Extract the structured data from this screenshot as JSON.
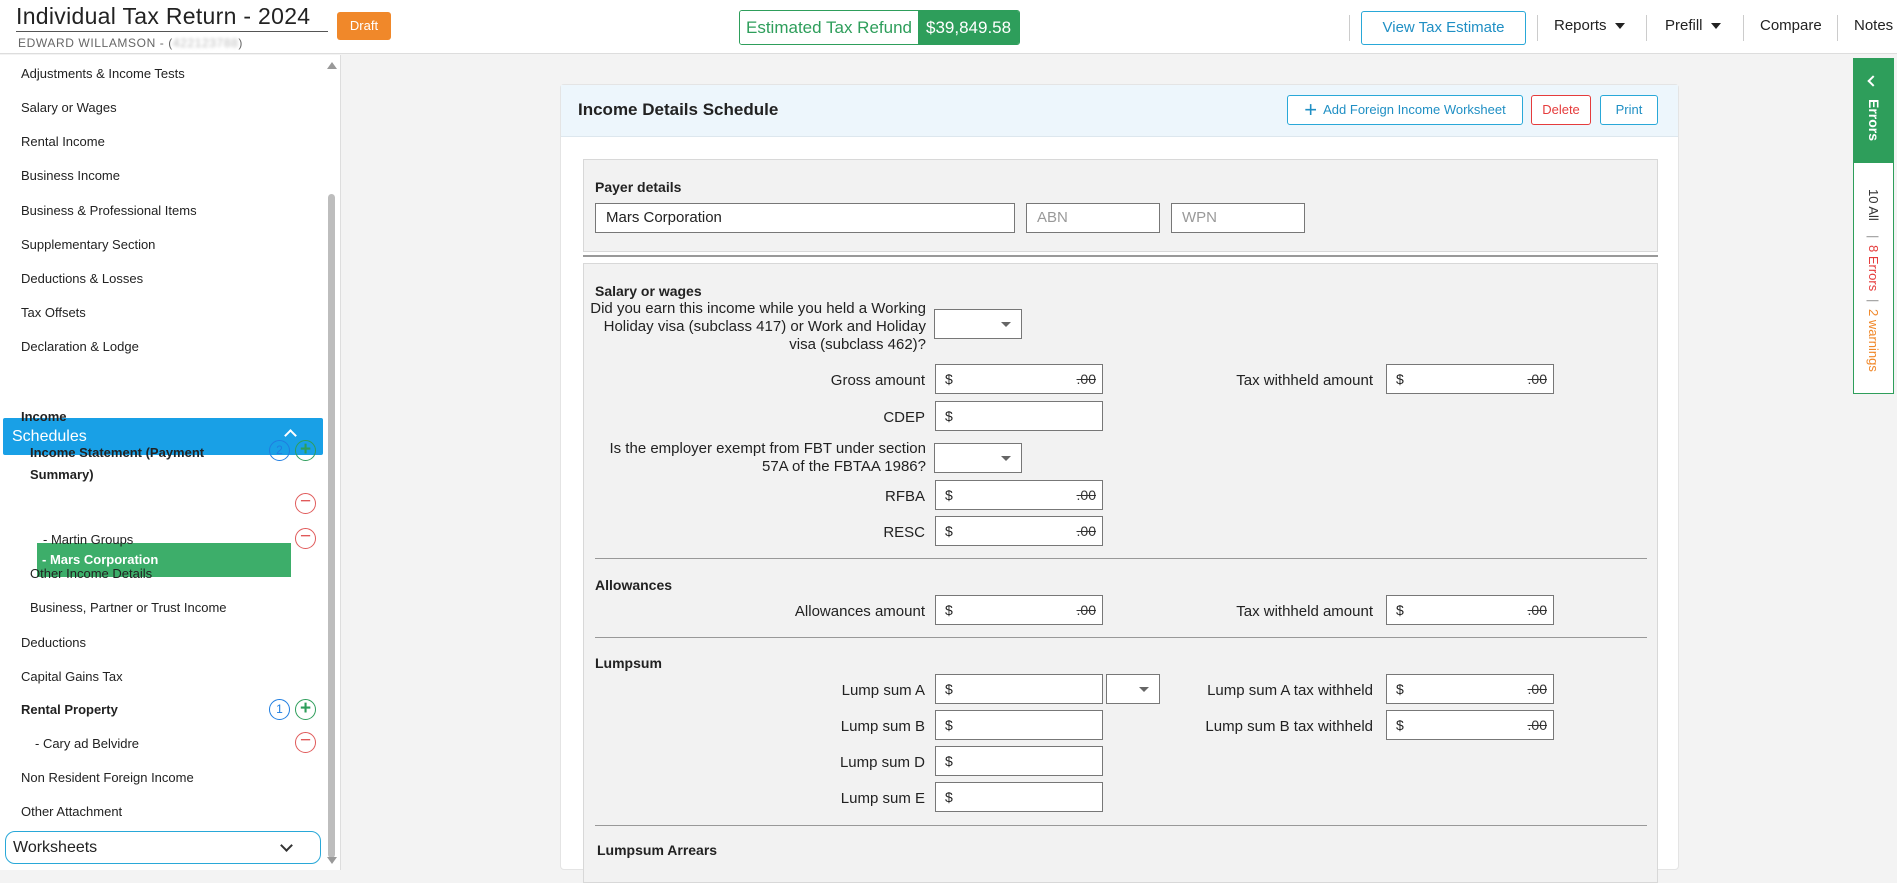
{
  "header": {
    "title": "Individual Tax Return - 2024",
    "client_name": "EDWARD WILLAMSON - (",
    "client_id_masked": "422123788",
    "client_close": ")",
    "status_badge": "Draft",
    "refund_label": "Estimated Tax Refund",
    "refund_amount": "$39,849.58",
    "view_estimate": "View Tax Estimate",
    "nav": [
      "Reports",
      "Prefill",
      "Compare",
      "Notes"
    ]
  },
  "sidebar": {
    "top_items": [
      "Adjustments & Income Tests",
      "Salary or Wages",
      "Rental Income",
      "Business Income",
      "Business & Professional Items",
      "Supplementary Section",
      "Deductions & Losses",
      "Tax Offsets",
      "Declaration & Lodge"
    ],
    "schedules_label": "Schedules",
    "income_label": "Income",
    "income_statement_label": "Income Statement (Payment Summary)",
    "income_statement_count": "2",
    "payers": [
      "- Mars Corporation",
      "- Martin Groups"
    ],
    "other_income": "Other Income Details",
    "business_partner": "Business, Partner or Trust Income",
    "deductions": "Deductions",
    "cgt": "Capital Gains Tax",
    "rental_property": "Rental Property",
    "rental_count": "1",
    "rental_items": [
      "- Cary ad Belvidre"
    ],
    "non_resident": "Non Resident Foreign Income",
    "other_attachment": "Other Attachment",
    "worksheets": "Worksheets"
  },
  "card": {
    "title": "Income Details Schedule",
    "add_foreign": "Add Foreign Income Worksheet",
    "delete": "Delete",
    "print": "Print"
  },
  "payer": {
    "section": "Payer details",
    "name_value": "Mars Corporation",
    "abn_placeholder": "ABN",
    "wpn_placeholder": "WPN"
  },
  "salary": {
    "section": "Salary or wages",
    "whm_question": "Did you earn this income while you held a Working Holiday visa (subclass 417) or Work and Holiday visa (subclass 462)?",
    "gross_label": "Gross amount",
    "tax_withheld_label": "Tax withheld amount",
    "cdep_label": "CDEP",
    "fbt_question": "Is the employer exempt from FBT under section 57A of the FBTAA 1986?",
    "rfba_label": "RFBA",
    "resc_label": "RESC"
  },
  "allowances": {
    "section": "Allowances",
    "amount_label": "Allowances amount",
    "tax_withheld_label": "Tax withheld amount"
  },
  "lumpsum": {
    "section": "Lumpsum",
    "a_label": "Lump sum A",
    "b_label": "Lump sum B",
    "d_label": "Lump sum D",
    "e_label": "Lump sum E",
    "a_tax_label": "Lump sum A tax withheld",
    "b_tax_label": "Lump sum B tax withheld"
  },
  "arrears": {
    "section": "Lumpsum Arrears"
  },
  "money": {
    "currency": "$",
    "cents": ".00"
  },
  "errors_panel": {
    "tab_label": "Errors",
    "all": "10 All",
    "errors": "8 Errors",
    "warnings": "2 warnings",
    "sep": "|"
  },
  "colors": {
    "accent": "#19a0e6",
    "green": "#2e9e5b",
    "orange": "#f0882a",
    "red": "#e53c3c"
  }
}
